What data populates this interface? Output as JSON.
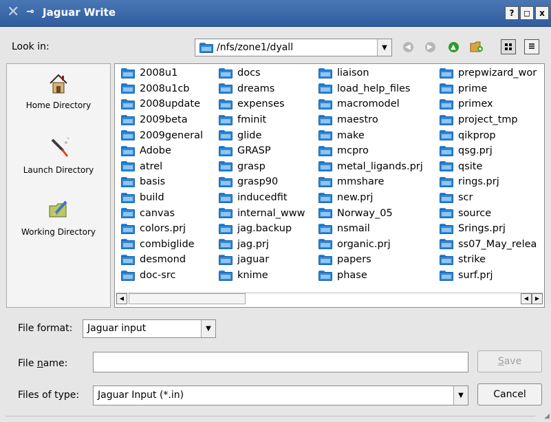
{
  "window": {
    "title": "Jaguar Write",
    "help_button": "?",
    "maximize_button": "◻",
    "close_button": "x"
  },
  "lookin": {
    "label": "Look in:",
    "path": "/nfs/zone1/dyall"
  },
  "sidebar": {
    "items": [
      {
        "label": "Home Directory"
      },
      {
        "label": "Launch Directory"
      },
      {
        "label": "Working Directory"
      }
    ]
  },
  "files": {
    "columns": [
      [
        "2008u1",
        "2008u1cb",
        "2008update",
        "2009beta",
        "2009general",
        "Adobe",
        "atrel",
        "basis",
        "build",
        "canvas",
        "colors.prj",
        "combiglide",
        "desmond",
        "doc-src"
      ],
      [
        "docs",
        "dreams",
        "expenses",
        "fminit",
        "glide",
        "GRASP",
        "grasp",
        "grasp90",
        "inducedfit",
        "internal_www",
        "jag.backup",
        "jag.prj",
        "jaguar",
        "knime"
      ],
      [
        "liaison",
        "load_help_files",
        "macromodel",
        "maestro",
        "make",
        "mcpro",
        "metal_ligands.prj",
        "mmshare",
        "new.prj",
        "Norway_05",
        "nsmail",
        "organic.prj",
        "papers",
        "phase"
      ],
      [
        "prepwizard_wor",
        "prime",
        "primex",
        "project_tmp",
        "qikprop",
        "qsg.prj",
        "qsite",
        "rings.prj",
        "scr",
        "source",
        "Srings.prj",
        "ss07_May_relea",
        "strike",
        "surf.prj"
      ]
    ]
  },
  "file_format": {
    "label": "File format:",
    "value": "Jaguar input"
  },
  "file_name": {
    "label_pre": "File ",
    "label_u": "n",
    "label_post": "ame:",
    "value": ""
  },
  "save_button": {
    "label_u": "S",
    "label_rest": "ave"
  },
  "files_of_type": {
    "label": "Files of type:",
    "value": "Jaguar Input (*.in)"
  },
  "cancel_button": {
    "label": "Cancel"
  }
}
